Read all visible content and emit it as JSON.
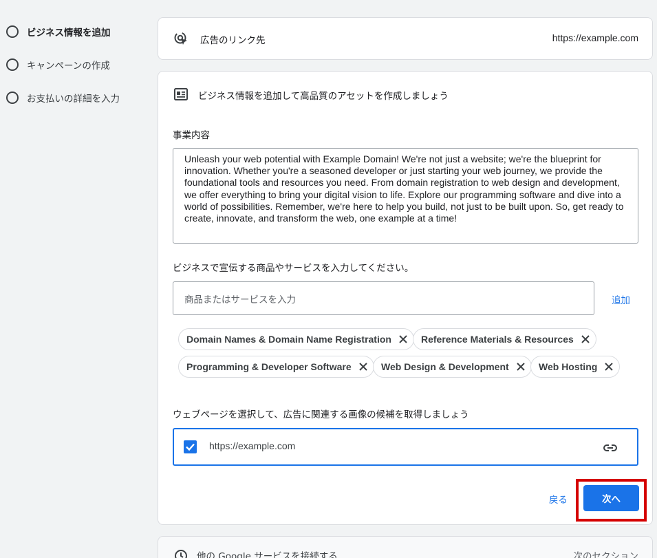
{
  "sidebar": {
    "steps": [
      {
        "label": "ビジネス情報を追加",
        "active": true
      },
      {
        "label": "キャンペーンの作成",
        "active": false
      },
      {
        "label": "お支払いの詳細を入力",
        "active": false
      }
    ]
  },
  "ad_link": {
    "title": "広告のリンク先",
    "url": "https://example.com",
    "icon": "cursor-click-icon"
  },
  "business": {
    "header": "ビジネス情報を追加して高品質のアセットを作成しましょう",
    "header_icon": "article-icon",
    "description_label": "事業内容",
    "description": "Unleash your web potential with Example Domain! We're not just a website; we're the blueprint for innovation. Whether you're a seasoned developer or just starting your web journey, we provide the foundational tools and resources you need. From domain registration to web design and development, we offer everything to bring your digital vision to life. Explore our programming software and dive into a world of possibilities. Remember, we're here to help you build, not just to be built upon. So, get ready to create, innovate, and transform the web, one example at a time!",
    "products_label": "ビジネスで宣伝する商品やサービスを入力してください。",
    "products_placeholder": "商品またはサービスを入力",
    "add_label": "追加",
    "chips": [
      "Domain Names & Domain Name Registration",
      "Reference Materials & Resources",
      "Programming & Developer Software",
      "Web Design & Development",
      "Web Hosting"
    ],
    "webpage_label": "ウェブページを選択して、広告に関連する画像の候補を取得しましょう",
    "webpage_url": "https://example.com",
    "webpage_checked": true,
    "back_label": "戻る",
    "next_label": "次へ"
  },
  "other_services": {
    "title": "他の Google サービスを接続する",
    "right": "次のセクション",
    "icon": "clock-icon"
  },
  "colors": {
    "accent": "#1a73e8",
    "highlight": "#d50000"
  }
}
